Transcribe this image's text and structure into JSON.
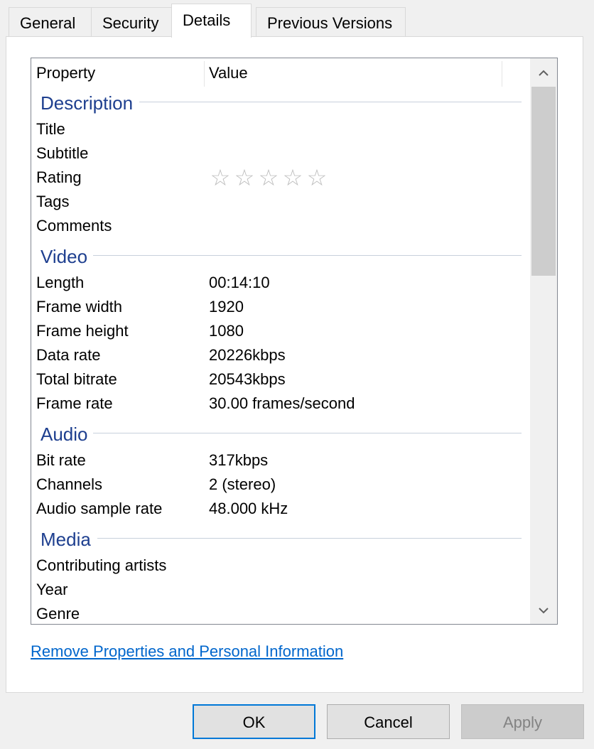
{
  "tabs": [
    {
      "label": "General"
    },
    {
      "label": "Security"
    },
    {
      "label": "Details"
    },
    {
      "label": "Previous Versions"
    }
  ],
  "header": {
    "property": "Property",
    "value": "Value"
  },
  "groups": {
    "description": {
      "title": "Description",
      "rows": [
        {
          "name": "Title",
          "value": ""
        },
        {
          "name": "Subtitle",
          "value": ""
        },
        {
          "name": "Rating",
          "value": ""
        },
        {
          "name": "Tags",
          "value": ""
        },
        {
          "name": "Comments",
          "value": ""
        }
      ]
    },
    "video": {
      "title": "Video",
      "rows": [
        {
          "name": "Length",
          "value": "00:14:10"
        },
        {
          "name": "Frame width",
          "value": "1920"
        },
        {
          "name": "Frame height",
          "value": "1080"
        },
        {
          "name": "Data rate",
          "value": "20226kbps"
        },
        {
          "name": "Total bitrate",
          "value": "20543kbps"
        },
        {
          "name": "Frame rate",
          "value": "30.00 frames/second"
        }
      ]
    },
    "audio": {
      "title": "Audio",
      "rows": [
        {
          "name": "Bit rate",
          "value": "317kbps"
        },
        {
          "name": "Channels",
          "value": "2 (stereo)"
        },
        {
          "name": "Audio sample rate",
          "value": "48.000 kHz"
        }
      ]
    },
    "media": {
      "title": "Media",
      "rows": [
        {
          "name": "Contributing artists",
          "value": ""
        },
        {
          "name": "Year",
          "value": ""
        },
        {
          "name": "Genre",
          "value": ""
        }
      ]
    }
  },
  "rating": {
    "stars": 0,
    "max": 5,
    "star_glyph": "☆"
  },
  "link": {
    "label": "Remove Properties and Personal Information"
  },
  "buttons": {
    "ok": "OK",
    "cancel": "Cancel",
    "apply": "Apply"
  },
  "colors": {
    "group_title": "#1e3f8f",
    "link": "#0066cc",
    "default_button_border": "#0078d7"
  }
}
